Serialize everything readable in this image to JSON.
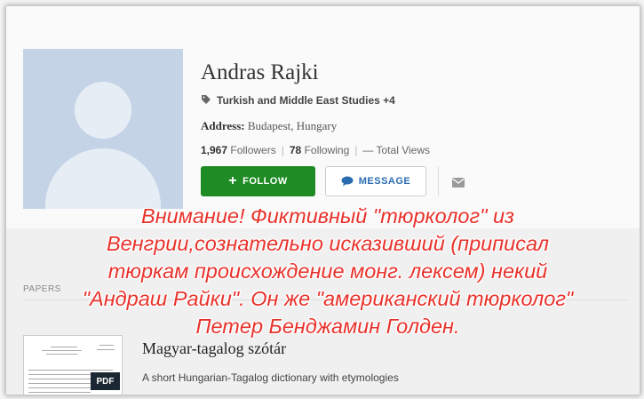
{
  "profile": {
    "name": "Andras Rajki",
    "tags": "Turkish and Middle East Studies +4",
    "address_label": "Address:",
    "address_value": "Budapest, Hungary",
    "followers_count": "1,967",
    "followers_label": "Followers",
    "following_count": "78",
    "following_label": "Following",
    "total_views": "— Total Views",
    "follow_label": "FOLLOW",
    "message_label": "MESSAGE"
  },
  "papers": {
    "section_label": "PAPERS",
    "items": [
      {
        "title": "Magyar-tagalog szótár",
        "description": "A short Hungarian-Tagalog dictionary with etymologies",
        "badge": "PDF"
      }
    ]
  },
  "overlay": {
    "lines": [
      "Внимание! Фиктивный \"тюрколог\" из",
      "Венгрии,сознательно исказивший  (приписал",
      "тюркам происхождение монг. лексем) некий",
      "\"Андраш Райки\". Он же \"американский тюрколог\"",
      "Петер Бенджамин Голден."
    ]
  },
  "colors": {
    "follow_bg": "#1f8b24",
    "message_text": "#2b6cb0",
    "overlay_text": "#e8322b",
    "avatar_bg": "#c4d4e6"
  },
  "icons": [
    "tag-icon",
    "plus-icon",
    "chat-bubble-icon",
    "mail-icon",
    "avatar-placeholder"
  ]
}
